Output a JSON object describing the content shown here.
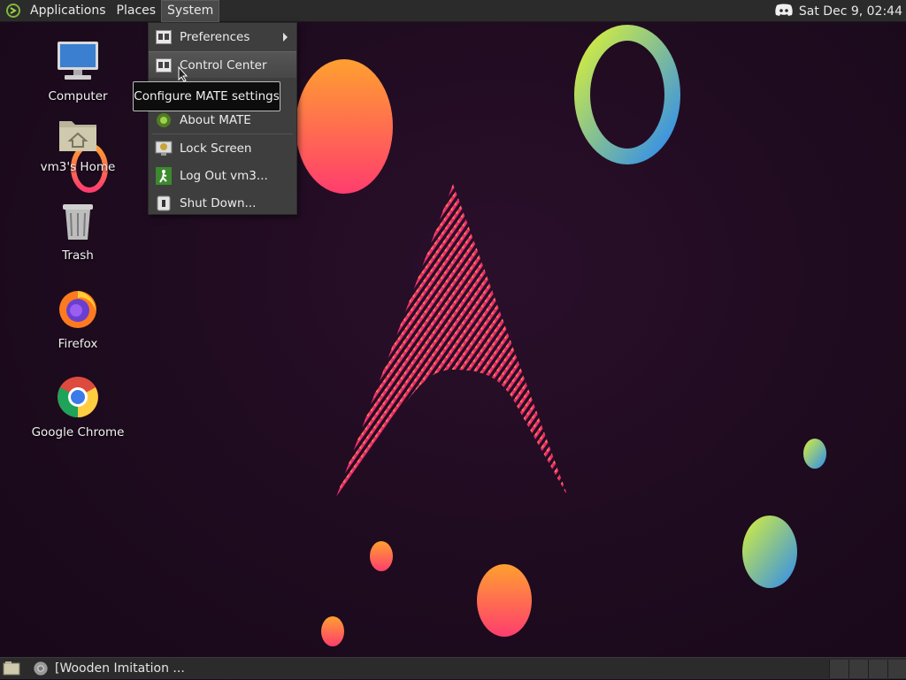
{
  "top_panel": {
    "menus": [
      "Applications",
      "Places",
      "System"
    ],
    "clock": "Sat Dec  9, 02:44",
    "tray_icons": [
      "discord-icon"
    ]
  },
  "desktop_icons": [
    {
      "label": "Computer",
      "icon": "computer-icon"
    },
    {
      "label": "vm3's Home",
      "icon": "home-folder-icon"
    },
    {
      "label": "Trash",
      "icon": "trash-icon"
    },
    {
      "label": "Firefox",
      "icon": "firefox-icon"
    },
    {
      "label": "Google Chrome",
      "icon": "chrome-icon"
    }
  ],
  "system_menu": {
    "items": [
      {
        "label": "Preferences",
        "icon": "preferences-icon",
        "submenu": true
      },
      {
        "label": "Control Center",
        "icon": "control-center-icon",
        "highlighted": true
      },
      {
        "label": "About MATE",
        "icon": "mate-logo-icon"
      },
      {
        "label": "Lock Screen",
        "icon": "lock-screen-icon"
      },
      {
        "label": "Log Out vm3...",
        "icon": "log-out-icon"
      },
      {
        "label": "Shut Down...",
        "icon": "shut-down-icon"
      }
    ]
  },
  "tooltip": "Configure MATE settings",
  "bottom_panel": {
    "task_label": "[Wooden Imitation ...",
    "workspace_count": 4
  },
  "colors": {
    "panel": "#2b2b2b",
    "menu_bg": "#3e3e3e",
    "desktop_bg": "#1e0b1f",
    "accent_pink": "#e6286e",
    "accent_orange": "#ff9a2e"
  }
}
